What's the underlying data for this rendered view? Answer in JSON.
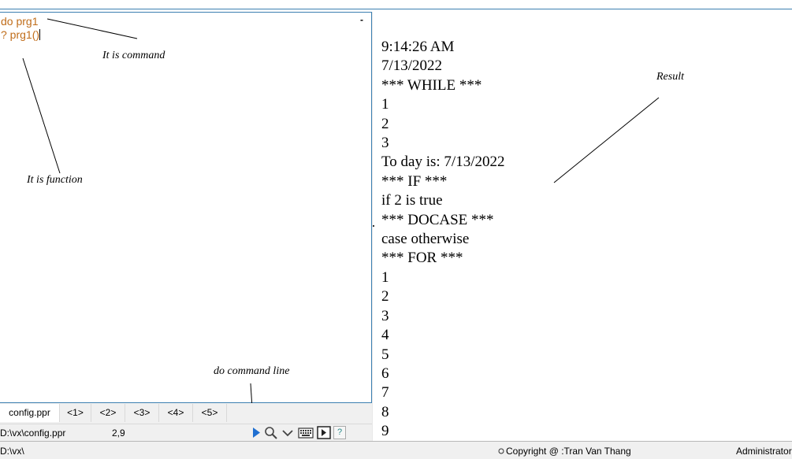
{
  "editor": {
    "lines": [
      "do prg1",
      "? prg1()"
    ],
    "collapse_glyph": "-"
  },
  "annotations": {
    "command": "It is command",
    "function": "It is function",
    "result": "Result",
    "do_command_line": "do command line"
  },
  "tabs": [
    "config.ppr",
    "<1>",
    "<2>",
    "<3>",
    "<4>",
    "<5>"
  ],
  "status": {
    "path": "D:\\vx\\config.ppr",
    "cursor": "2,9",
    "help_glyph": "?"
  },
  "output_lines": [
    "9:14:26 AM",
    "7/13/2022",
    "*** WHILE ***",
    "1",
    "2",
    "3",
    "To day is: 7/13/2022",
    "*** IF ***",
    "if 2 is true",
    "*** DOCASE ***",
    "case otherwise",
    "*** FOR ***",
    "1",
    "2",
    "3",
    "4",
    "5",
    "6",
    "7",
    "8",
    "9"
  ],
  "bottom_bar": {
    "path": "D:\\vx\\",
    "copyright": "Copyright @ :Tran Van Thang",
    "user": "Administrator"
  },
  "colors": {
    "code": "#c06d1a",
    "border": "#3c7fb1",
    "run_icon": "#1f6fd1"
  },
  "icons": [
    "run-icon",
    "search-icon",
    "chevron-down-icon",
    "keyboard-icon",
    "panel-toggle-icon",
    "help-icon",
    "status-circle-icon"
  ]
}
